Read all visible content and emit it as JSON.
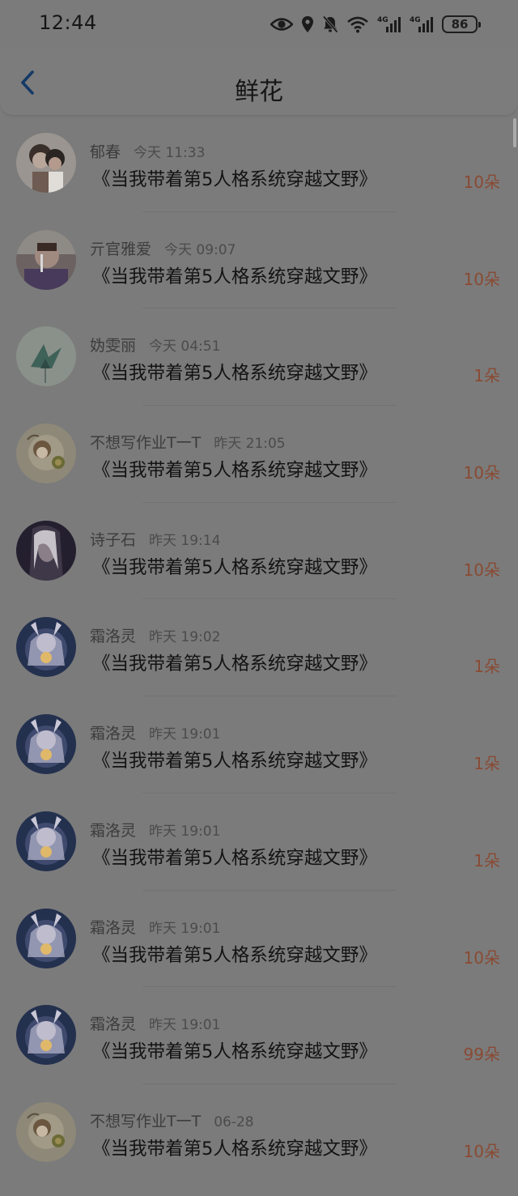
{
  "status_bar": {
    "time": "12:44",
    "network_1": "4G",
    "network_2": "4G",
    "battery": "86",
    "icons": [
      "eye-icon",
      "location-icon",
      "bell-off-icon",
      "wifi-icon",
      "signal-icon",
      "signal-icon",
      "battery-icon"
    ]
  },
  "header": {
    "title": "鲜花",
    "back_icon": "chevron-left-icon"
  },
  "colors": {
    "accent_flowers": "#8a4a33",
    "background": "#7b7b7b"
  },
  "items": [
    {
      "name": "郁春",
      "time": "今天 11:33",
      "book": "《当我带着第5人格系统穿越文野》",
      "flowers": "10朵"
    },
    {
      "name": "亓官雅爱",
      "time": "今天 09:07",
      "book": "《当我带着第5人格系统穿越文野》",
      "flowers": "10朵"
    },
    {
      "name": "妫雯丽",
      "time": "今天 04:51",
      "book": "《当我带着第5人格系统穿越文野》",
      "flowers": "1朵"
    },
    {
      "name": "不想写作业T一T",
      "time": "昨天 21:05",
      "book": "《当我带着第5人格系统穿越文野》",
      "flowers": "10朵"
    },
    {
      "name": "诗子石",
      "time": "昨天 19:14",
      "book": "《当我带着第5人格系统穿越文野》",
      "flowers": "10朵"
    },
    {
      "name": "霜洛灵",
      "time": "昨天 19:02",
      "book": "《当我带着第5人格系统穿越文野》",
      "flowers": "1朵"
    },
    {
      "name": "霜洛灵",
      "time": "昨天 19:01",
      "book": "《当我带着第5人格系统穿越文野》",
      "flowers": "1朵"
    },
    {
      "name": "霜洛灵",
      "time": "昨天 19:01",
      "book": "《当我带着第5人格系统穿越文野》",
      "flowers": "1朵"
    },
    {
      "name": "霜洛灵",
      "time": "昨天 19:01",
      "book": "《当我带着第5人格系统穿越文野》",
      "flowers": "10朵"
    },
    {
      "name": "霜洛灵",
      "time": "昨天 19:01",
      "book": "《当我带着第5人格系统穿越文野》",
      "flowers": "99朵"
    },
    {
      "name": "不想写作业T一T",
      "time": "06-28",
      "book": "《当我带着第5人格系统穿越文野》",
      "flowers": "10朵"
    }
  ]
}
